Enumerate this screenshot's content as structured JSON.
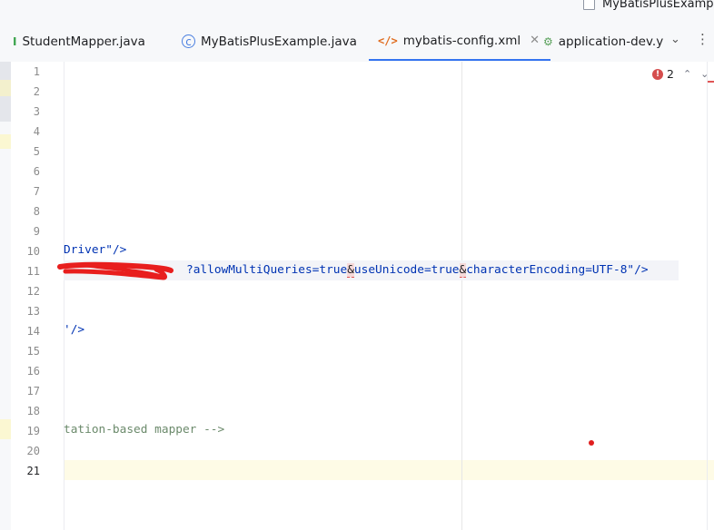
{
  "project": {
    "title": "MyBatisPlusExample"
  },
  "tabs": [
    {
      "label": "StudentMapper.java",
      "icon": "interface-icon",
      "glyph": "I",
      "active": false
    },
    {
      "label": "MyBatisPlusExample.java",
      "icon": "class-icon",
      "glyph": "c",
      "active": false
    },
    {
      "label": "mybatis-config.xml",
      "icon": "xml-icon",
      "glyph": "</>",
      "active": true,
      "close": "✕"
    },
    {
      "label": "application-dev.y",
      "icon": "yaml-icon",
      "glyph": "⚙",
      "active": false
    }
  ],
  "tab_controls": {
    "more_tabs": "⌄",
    "menu": "⋮"
  },
  "inspection": {
    "error_count": "2",
    "error_glyph": "!",
    "up": "⌃",
    "down": "⌄"
  },
  "editor": {
    "line_numbers": [
      "1",
      "2",
      "3",
      "4",
      "5",
      "6",
      "7",
      "8",
      "9",
      "10",
      "11",
      "12",
      "13",
      "14",
      "15",
      "16",
      "17",
      "18",
      "19",
      "20",
      "21"
    ],
    "current_line": "21",
    "lines": {
      "l10": {
        "str": "Driver\"",
        "tag": "/>"
      },
      "l11": {
        "part1": "?allowMultiQueries=true",
        "amp1": "&",
        "part2": "useUnicode=true",
        "amp2": "&",
        "part3": "characterEncoding=UTF-8\"",
        "tag": "/>"
      },
      "l14": {
        "str": "'",
        "tag": "/>"
      },
      "l19": {
        "comment": "tation-based mapper -->"
      }
    }
  },
  "colors": {
    "accent": "#3574f0",
    "error": "#d54d4d",
    "string": "#067d17",
    "keyword": "#0033b3",
    "current_line": "#fefbe6"
  }
}
